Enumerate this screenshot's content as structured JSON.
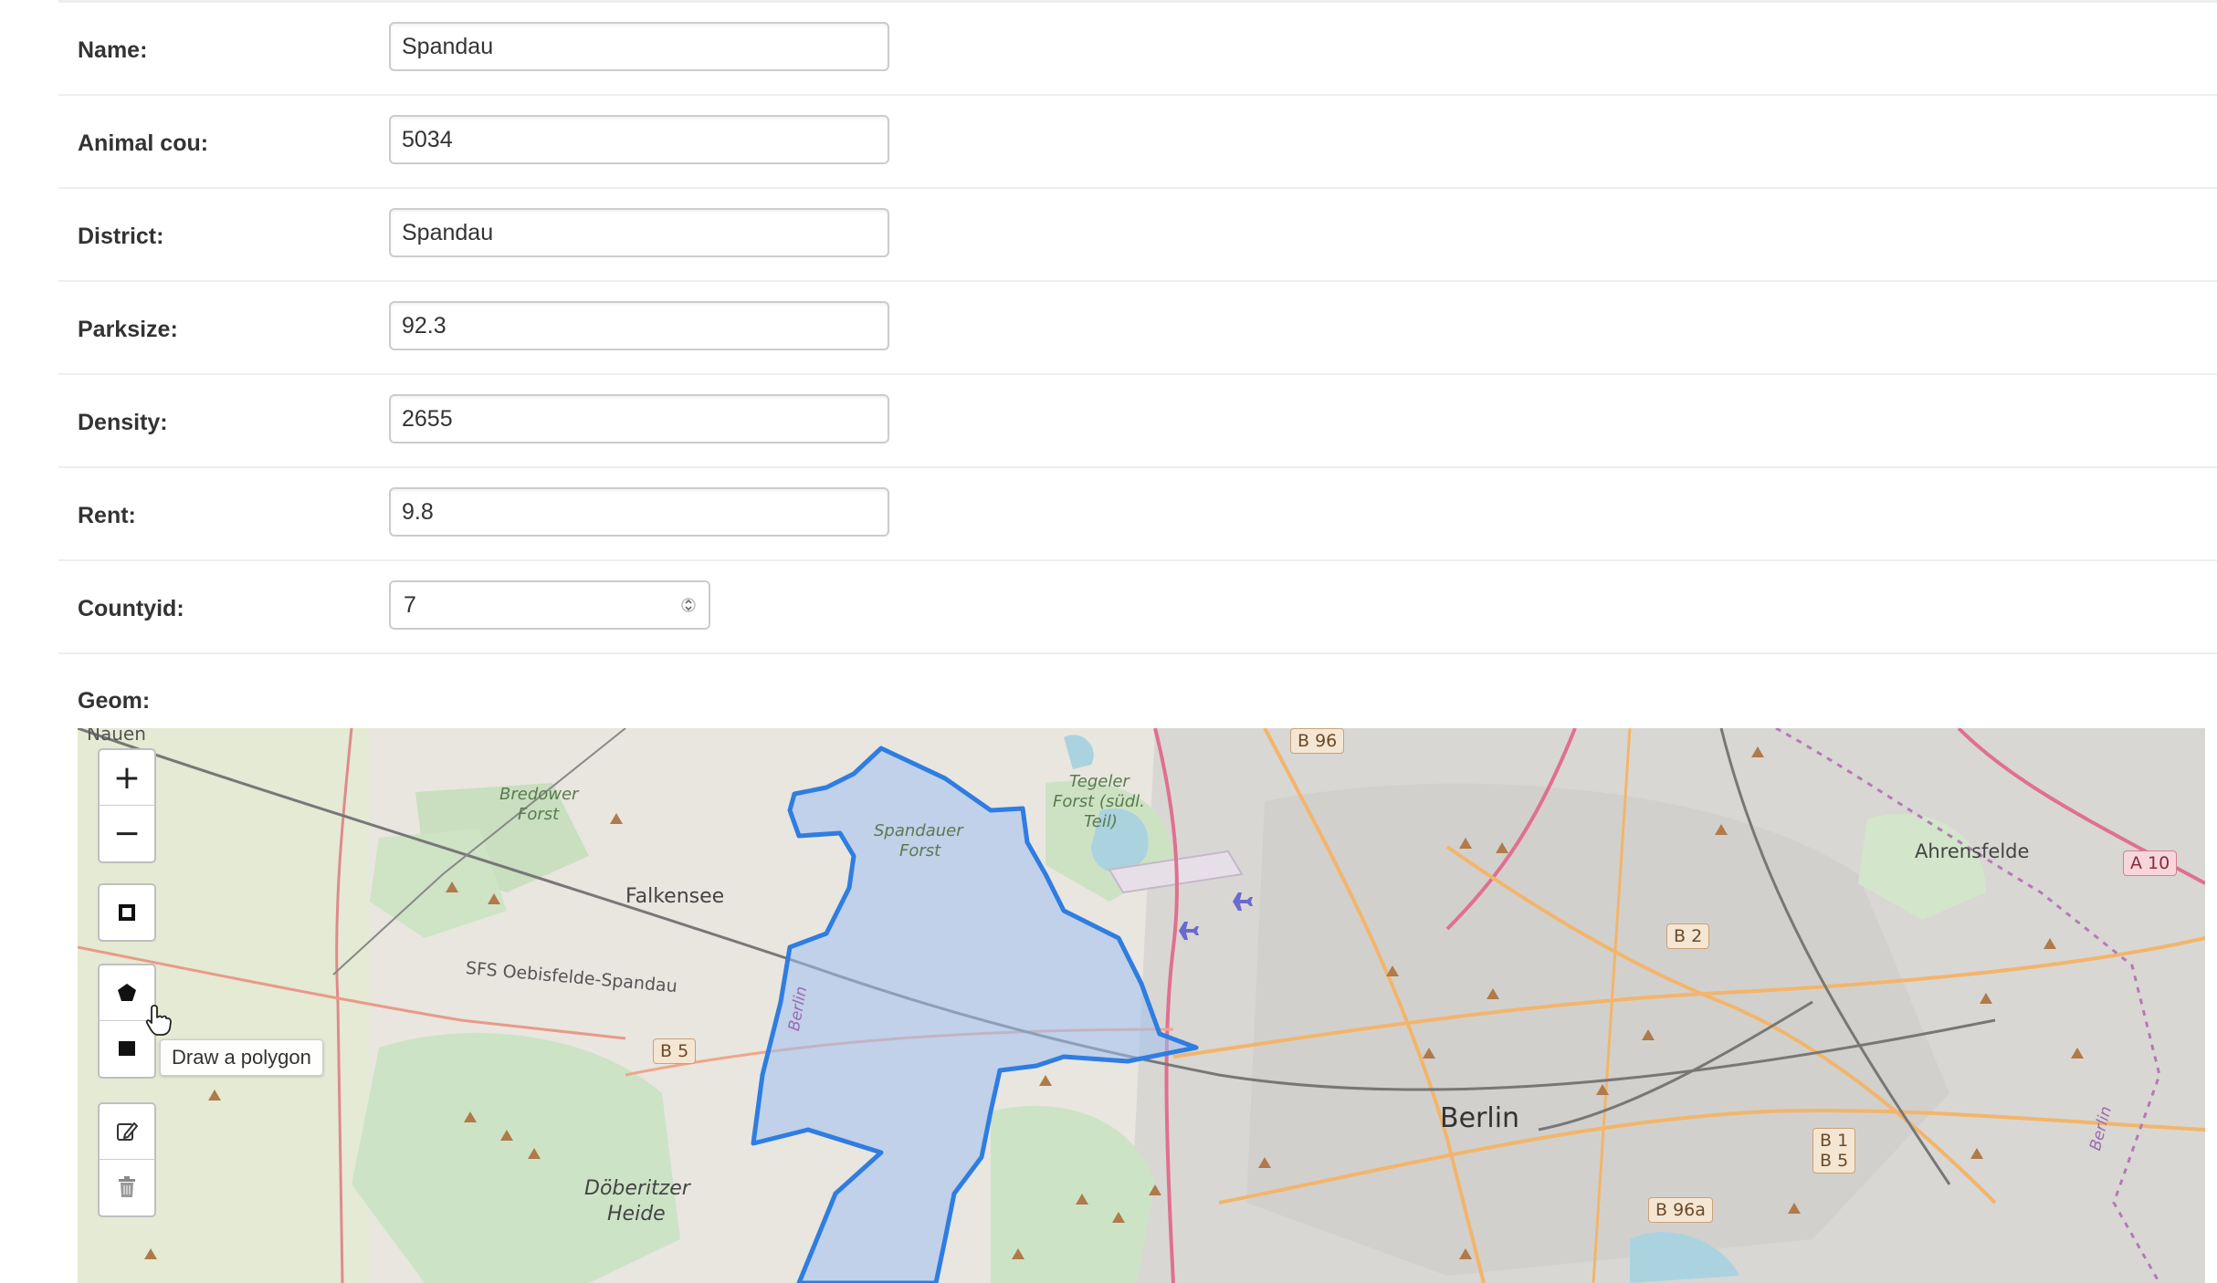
{
  "form": {
    "fields": [
      {
        "label": "Name:",
        "value": "Spandau"
      },
      {
        "label": "Animal cou:",
        "value": "5034"
      },
      {
        "label": "District:",
        "value": "Spandau"
      },
      {
        "label": "Parksize:",
        "value": "92.3"
      },
      {
        "label": "Density:",
        "value": "2655"
      },
      {
        "label": "Rent:",
        "value": "9.8"
      }
    ],
    "countyid": {
      "label": "Countyid:",
      "value": "7"
    },
    "geom": {
      "label": "Geom:"
    }
  },
  "map": {
    "controls": {
      "zoom_in": "+",
      "zoom_out": "−",
      "tooltip": "Draw a polygon"
    },
    "places": {
      "nauen": "Nauen",
      "falkensee": "Falkensee",
      "berlin": "Berlin",
      "ahrensfelde": "Ahrensfelde",
      "bredower_forst_1": "Bredower",
      "bredower_forst_2": "Forst",
      "spandauer_forst_1": "Spandauer",
      "spandauer_forst_2": "Forst",
      "tegeler_forst_1": "Tegeler",
      "tegeler_forst_2": "Forst (südl.",
      "tegeler_forst_3": "Teil)",
      "doberitzer_1": "Döberitzer",
      "doberitzer_2": "Heide",
      "rail_line": "SFS Oebisfelde-Spandau",
      "berlin_border_west": "Berlin",
      "berlin_border_east": "Berlin"
    },
    "road_shields": {
      "b96": "B 96",
      "b2": "B 2",
      "b5": "B 5",
      "b1_b5_1": "B 1",
      "b1_b5_2": "B 5",
      "b96a": "B 96a",
      "a10": "A 10"
    },
    "colors": {
      "polygon_stroke": "#2f7de1",
      "polygon_fill": "#9fbff0",
      "forest": "#c8dfc0",
      "urban": "#d6d3cf",
      "major_road": "#f2b56b",
      "motorway": "#e07090"
    }
  }
}
